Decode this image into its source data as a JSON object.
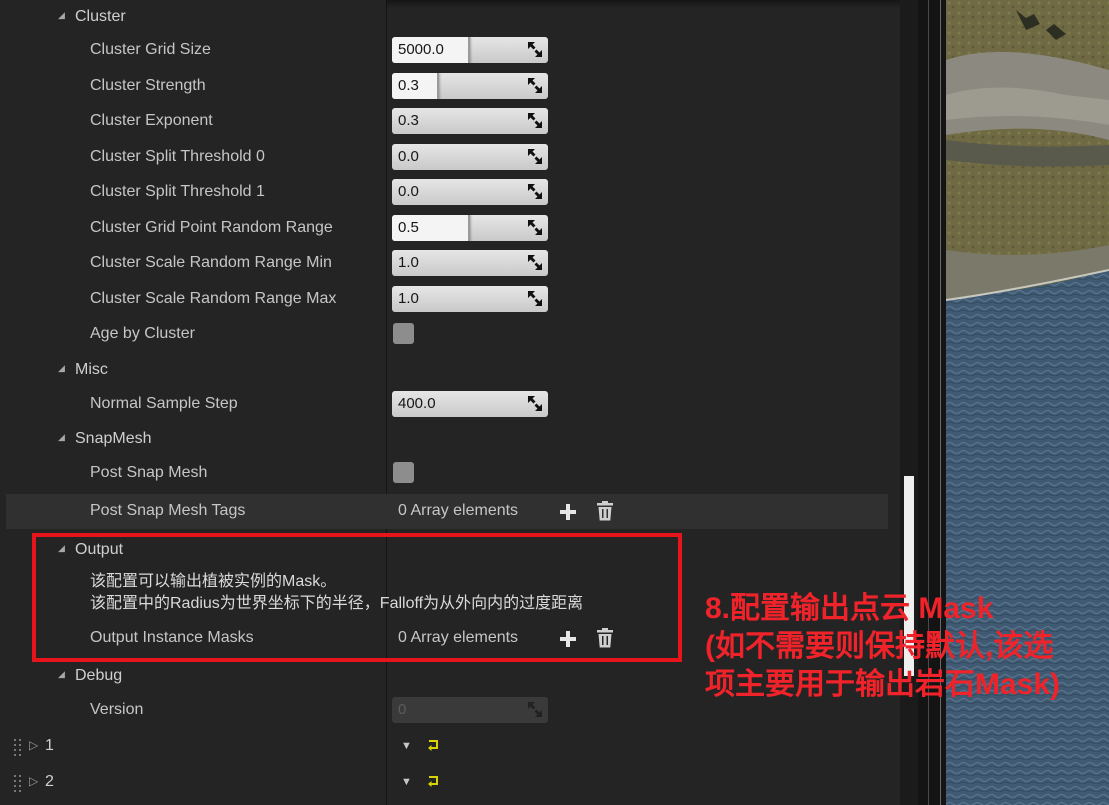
{
  "sections": {
    "cluster": "Cluster",
    "misc": "Misc",
    "snapmesh": "SnapMesh",
    "output": "Output",
    "debug": "Debug"
  },
  "cluster_rows": [
    {
      "label": "Cluster Grid Size",
      "value": "5000.0",
      "slider_fill": 0.49
    },
    {
      "label": "Cluster Strength",
      "value": "0.3",
      "slider_fill": 0.29
    },
    {
      "label": "Cluster Exponent",
      "value": "0.3",
      "slider_fill": 0
    },
    {
      "label": "Cluster Split Threshold 0",
      "value": "0.0",
      "slider_fill": 0
    },
    {
      "label": "Cluster Split Threshold 1",
      "value": "0.0",
      "slider_fill": 0
    },
    {
      "label": "Cluster Grid Point Random Range",
      "value": "0.5",
      "slider_fill": 0.49
    },
    {
      "label": "Cluster Scale Random Range Min",
      "value": "1.0",
      "slider_fill": 0
    },
    {
      "label": "Cluster Scale Random Range Max",
      "value": "1.0",
      "slider_fill": 0
    }
  ],
  "age_by_cluster": {
    "label": "Age by Cluster",
    "checked": false
  },
  "misc_rows": [
    {
      "label": "Normal Sample Step",
      "value": "400.0"
    }
  ],
  "snapmesh_rows": {
    "post_snap_mesh": {
      "label": "Post Snap Mesh",
      "checked": false
    },
    "post_snap_mesh_tags": {
      "label": "Post Snap Mesh Tags",
      "array_text": "0 Array elements"
    }
  },
  "output": {
    "desc_line1": "该配置可以输出植被实例的Mask。",
    "desc_line2": "该配置中的Radius为世界坐标下的半径，Falloff为从外向内的过度距离",
    "instance_masks": {
      "label": "Output Instance Masks",
      "array_text": "0 Array elements"
    }
  },
  "debug_rows": [
    {
      "label": "Version",
      "value": "0"
    }
  ],
  "array_items": [
    {
      "index": "1"
    },
    {
      "index": "2"
    }
  ],
  "annotation": {
    "line1": "8.配置输出点云 Mask",
    "line2": "(如不需要则保持默认,该选",
    "line3": "项主要用于输出岩石Mask)"
  },
  "colors": {
    "panel_bg": "#242424",
    "highlight_row": "#303030",
    "annotation_red": "#e8141b",
    "reset_icon_yellow": "#d9d400"
  }
}
